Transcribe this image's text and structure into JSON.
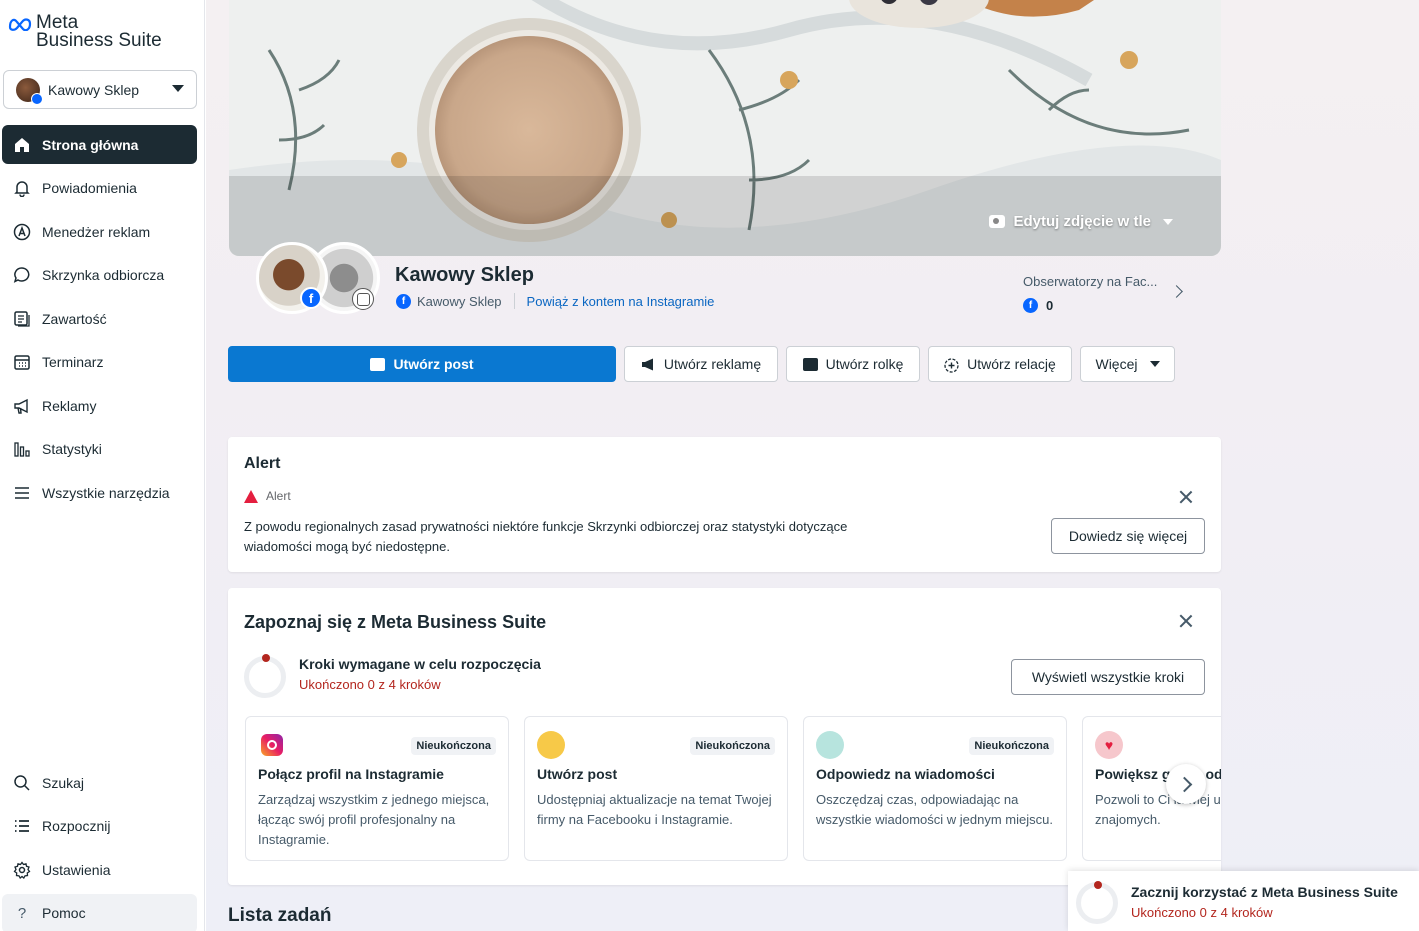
{
  "brand": {
    "line1": "Meta",
    "line2": "Business Suite"
  },
  "account": {
    "name": "Kawowy Sklep"
  },
  "nav": {
    "items": [
      {
        "label": "Strona główna",
        "icon": "home-icon"
      },
      {
        "label": "Powiadomienia",
        "icon": "bell-icon"
      },
      {
        "label": "Menedżer reklam",
        "icon": "ads-manager-icon"
      },
      {
        "label": "Skrzynka odbiorcza",
        "icon": "chat-bubble-icon"
      },
      {
        "label": "Zawartość",
        "icon": "content-icon"
      },
      {
        "label": "Terminarz",
        "icon": "calendar-icon"
      },
      {
        "label": "Reklamy",
        "icon": "megaphone-icon"
      },
      {
        "label": "Statystyki",
        "icon": "bar-chart-icon"
      },
      {
        "label": "Wszystkie narzędzia",
        "icon": "menu-icon"
      }
    ],
    "bottom": [
      {
        "label": "Szukaj",
        "icon": "search-icon"
      },
      {
        "label": "Rozpocznij",
        "icon": "list-icon"
      },
      {
        "label": "Ustawienia",
        "icon": "gear-icon"
      },
      {
        "label": "Pomoc",
        "icon": "question-icon"
      }
    ]
  },
  "cover": {
    "edit_label": "Edytuj zdjęcie w tle"
  },
  "page": {
    "name": "Kawowy Sklep",
    "fb_name": "Kawowy Sklep",
    "ig_link": "Powiąż z kontem na Instagramie",
    "followers_label": "Obserwatorzy na Fac...",
    "followers_value": "0"
  },
  "actions": {
    "create_post": "Utwórz post",
    "create_ad": "Utwórz reklamę",
    "create_reel": "Utwórz rolkę",
    "create_story": "Utwórz relację",
    "more": "Więcej"
  },
  "alert": {
    "title": "Alert",
    "tag": "Alert",
    "text": "Z powodu regionalnych zasad prywatności niektóre funkcje Skrzynki odbiorczej oraz statystyki dotyczące wiadomości mogą być niedostępne.",
    "button": "Dowiedz się więcej"
  },
  "intro": {
    "title": "Zapoznaj się z Meta Business Suite",
    "steps_title": "Kroki wymagane w celu rozpoczęcia",
    "steps_sub": "Ukończono 0 z 4 kroków",
    "view_all": "Wyświetl wszystkie kroki",
    "tiles": [
      {
        "icon": "instagram-icon",
        "badge": "Nieukończona",
        "title": "Połącz profil na Instagramie",
        "desc": "Zarządzaj wszystkim z jednego miejsca, łącząc swój profil profesjonalny na Instagramie."
      },
      {
        "icon": "post-icon",
        "badge": "Nieukończona",
        "title": "Utwórz post",
        "desc": "Udostępniaj aktualizacje na temat Twojej firmy na Facebooku i Instagramie."
      },
      {
        "icon": "messages-icon",
        "badge": "Nieukończona",
        "title": "Odpowiedz na wiadomości",
        "desc": "Oszczędzaj czas, odpowiadając na wszystkie wiadomości w jednym miejscu."
      },
      {
        "icon": "heart-icon",
        "badge": "",
        "title": "Powiększ grono odbiorców",
        "desc": "Pozwoli to Ci łatwiej uzyskiwać dostęp do znajomych."
      }
    ]
  },
  "tasks": {
    "title": "Lista zadań"
  },
  "toast": {
    "title": "Zacznij korzystać z Meta Business Suite",
    "sub": "Ukończono 0 z 4 kroków"
  },
  "colors": {
    "primary": "#0a78d1",
    "nav_active": "#1c2b33",
    "progress": "#b3261e"
  }
}
